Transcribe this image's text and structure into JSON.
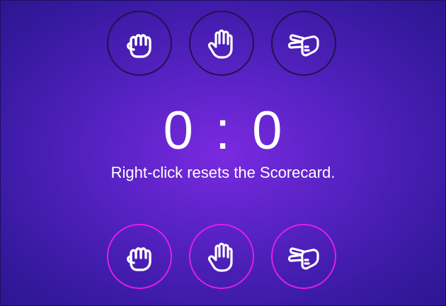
{
  "scoreboard": {
    "left_score": "0",
    "separator": ":",
    "right_score": "0"
  },
  "hint": "Right-click resets the Scorecard.",
  "opponent_choices": [
    {
      "icon": "fist-icon"
    },
    {
      "icon": "open-hand-icon"
    },
    {
      "icon": "scissors-hand-icon"
    }
  ],
  "player_choices": [
    {
      "icon": "fist-icon"
    },
    {
      "icon": "open-hand-icon"
    },
    {
      "icon": "scissors-hand-icon"
    }
  ],
  "colors": {
    "background_center": "#7a2ae0",
    "background_edge": "#2c1690",
    "opponent_ring": "#21124e",
    "player_ring": "#e01ee8",
    "text": "#ffffff"
  }
}
